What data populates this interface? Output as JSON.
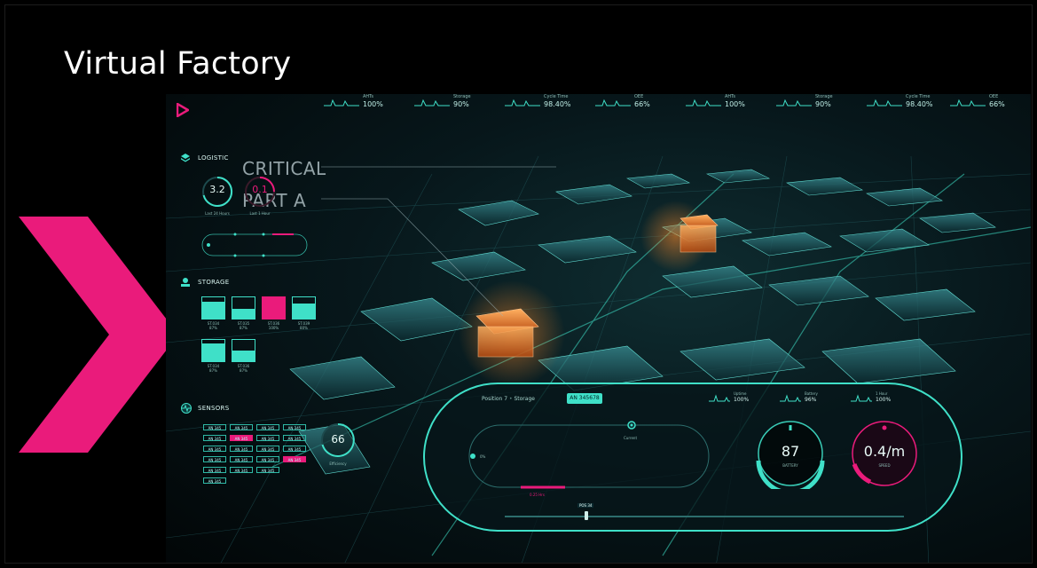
{
  "slide": {
    "title": "Virtual Factory"
  },
  "kpis": [
    {
      "label": "AHTs",
      "value": "100%"
    },
    {
      "label": "Storage",
      "value": "90%"
    },
    {
      "label": "Cycle Time",
      "value": "98.40%"
    },
    {
      "label": "OEE",
      "value": "66%"
    },
    {
      "label": "AHTs",
      "value": "100%"
    },
    {
      "label": "Storage",
      "value": "90%"
    },
    {
      "label": "Cycle Time",
      "value": "98.40%"
    },
    {
      "label": "OEE",
      "value": "66%"
    }
  ],
  "sidebar": {
    "logistic": {
      "label": "LOGISTIC",
      "gauge1_value": "3.2",
      "gauge1_sub": "Last 24 Hours",
      "gauge2_value": "0.1",
      "gauge2_sub": "Last 1 Hour"
    },
    "storage": {
      "label": "STORAGE",
      "cells": [
        {
          "label": "ST.034",
          "pct": "87%",
          "fill": 0.8
        },
        {
          "label": "ST.035",
          "pct": "87%",
          "fill": 0.45
        },
        {
          "label": "ST.036",
          "pct": "100%",
          "fill": 1.0
        },
        {
          "label": "ST.039",
          "pct": "80%",
          "fill": 0.7
        },
        {
          "label": "ST.034",
          "pct": "87%",
          "fill": 0.85
        },
        {
          "label": "ST.036",
          "pct": "87%",
          "fill": 0.5
        }
      ]
    },
    "sensors": {
      "label": "SENSORS",
      "efficiency_value": "66",
      "efficiency_label": "Efficiency"
    }
  },
  "overlay": {
    "critical": "CRITICAL",
    "part": "PART A"
  },
  "panel": {
    "breadcrumb_position": "Position 7",
    "breadcrumb_storage": "Storage",
    "active_tag": "AN 345678",
    "track_percent": "0%",
    "track_top_label": "Current",
    "progress_label": "0.25 Hrs",
    "slider_label": "POS 34",
    "mini_kpis": [
      {
        "label": "Uptime",
        "value": "100%"
      },
      {
        "label": "Battery",
        "value": "96%"
      },
      {
        "label": "1 Hour",
        "value": "100%"
      }
    ],
    "gauge_battery": {
      "value": "87",
      "label": "BATTERY",
      "level": 0.87
    },
    "gauge_speed": {
      "value": "0.4/m",
      "label": "SPEED",
      "level": 0.25
    }
  },
  "colors": {
    "accent": "#3fe0c8",
    "brand": "#ea1b7b",
    "warning": "#ff8a2a"
  }
}
